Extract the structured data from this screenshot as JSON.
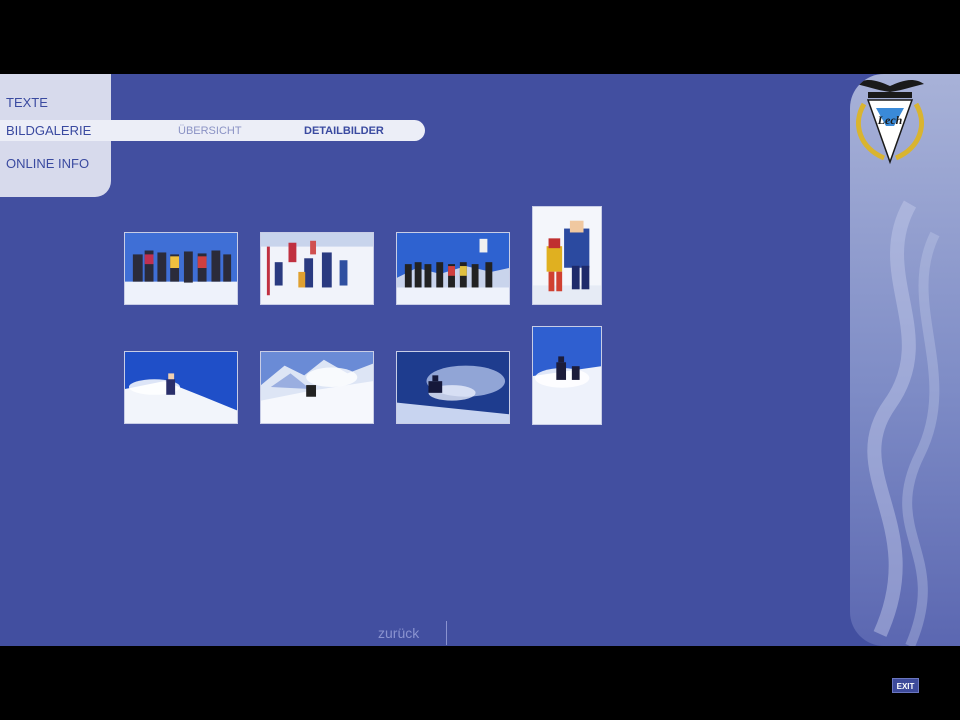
{
  "menu": {
    "texte": "TEXTE",
    "bildgalerie": "BILDGALERIE",
    "online_info": "ONLINE INFO"
  },
  "submenu": {
    "uebersicht": "ÜBERSICHT",
    "detailbilder": "DETAILBILDER"
  },
  "gallery": {
    "thumbnails": [
      {
        "subject": "ski-group-photo"
      },
      {
        "subject": "ski-kids-slalom"
      },
      {
        "subject": "ski-group-jump"
      },
      {
        "subject": "ski-instructor-child"
      },
      {
        "subject": "skier-powder-turn"
      },
      {
        "subject": "skier-mountain-descent"
      },
      {
        "subject": "skier-deep-powder"
      },
      {
        "subject": "skier-pair-powder"
      }
    ]
  },
  "footer": {
    "back_label": "zurück",
    "exit_label": "EXIT"
  },
  "colors": {
    "background": "#424fa0",
    "menu_box": "#d7daec",
    "accent_text": "#3a4aa0"
  }
}
